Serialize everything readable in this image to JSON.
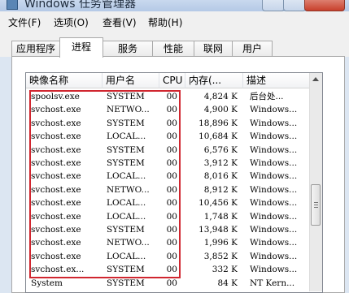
{
  "window": {
    "title": "Windows 任务管理器",
    "accent": "#c9d9ee"
  },
  "menu": [
    {
      "label": "文件(F)"
    },
    {
      "label": "选项(O)"
    },
    {
      "label": "查看(V)"
    },
    {
      "label": "帮助(H)"
    }
  ],
  "tabs": [
    {
      "label": "应用程序",
      "active": false
    },
    {
      "label": "进程",
      "active": true
    },
    {
      "label": "服务",
      "active": false
    },
    {
      "label": "性能",
      "active": false
    },
    {
      "label": "联网",
      "active": false
    },
    {
      "label": "用户",
      "active": false
    }
  ],
  "columns": {
    "image": "映像名称",
    "user": "用户名",
    "cpu": "CPU",
    "mem": "内存(...",
    "desc": "描述"
  },
  "processes": [
    {
      "image": "spoolsv.exe",
      "user": "SYSTEM",
      "cpu": "00",
      "mem": "4,824 K",
      "desc": "后台处..."
    },
    {
      "image": "svchost.exe",
      "user": "NETWO...",
      "cpu": "00",
      "mem": "4,900 K",
      "desc": "Windows..."
    },
    {
      "image": "svchost.exe",
      "user": "SYSTEM",
      "cpu": "00",
      "mem": "18,896 K",
      "desc": "Windows..."
    },
    {
      "image": "svchost.exe",
      "user": "LOCAL...",
      "cpu": "00",
      "mem": "10,684 K",
      "desc": "Windows..."
    },
    {
      "image": "svchost.exe",
      "user": "SYSTEM",
      "cpu": "00",
      "mem": "6,576 K",
      "desc": "Windows..."
    },
    {
      "image": "svchost.exe",
      "user": "SYSTEM",
      "cpu": "00",
      "mem": "3,912 K",
      "desc": "Windows..."
    },
    {
      "image": "svchost.exe",
      "user": "LOCAL...",
      "cpu": "00",
      "mem": "8,016 K",
      "desc": "Windows..."
    },
    {
      "image": "svchost.exe",
      "user": "NETWO...",
      "cpu": "00",
      "mem": "8,912 K",
      "desc": "Windows..."
    },
    {
      "image": "svchost.exe",
      "user": "LOCAL...",
      "cpu": "00",
      "mem": "10,456 K",
      "desc": "Windows..."
    },
    {
      "image": "svchost.exe",
      "user": "LOCAL...",
      "cpu": "00",
      "mem": "1,748 K",
      "desc": "Windows..."
    },
    {
      "image": "svchost.exe",
      "user": "SYSTEM",
      "cpu": "00",
      "mem": "13,948 K",
      "desc": "Windows..."
    },
    {
      "image": "svchost.exe",
      "user": "NETWO...",
      "cpu": "00",
      "mem": "1,996 K",
      "desc": "Windows..."
    },
    {
      "image": "svchost.exe",
      "user": "LOCAL...",
      "cpu": "00",
      "mem": "3,852 K",
      "desc": "Windows..."
    },
    {
      "image": "svchost.ex...",
      "user": "SYSTEM",
      "cpu": "00",
      "mem": "332 K",
      "desc": "Windows..."
    },
    {
      "image": "System",
      "user": "SYSTEM",
      "cpu": "00",
      "mem": "84 K",
      "desc": "NT Kern..."
    }
  ],
  "highlight_color": "#d0262f"
}
